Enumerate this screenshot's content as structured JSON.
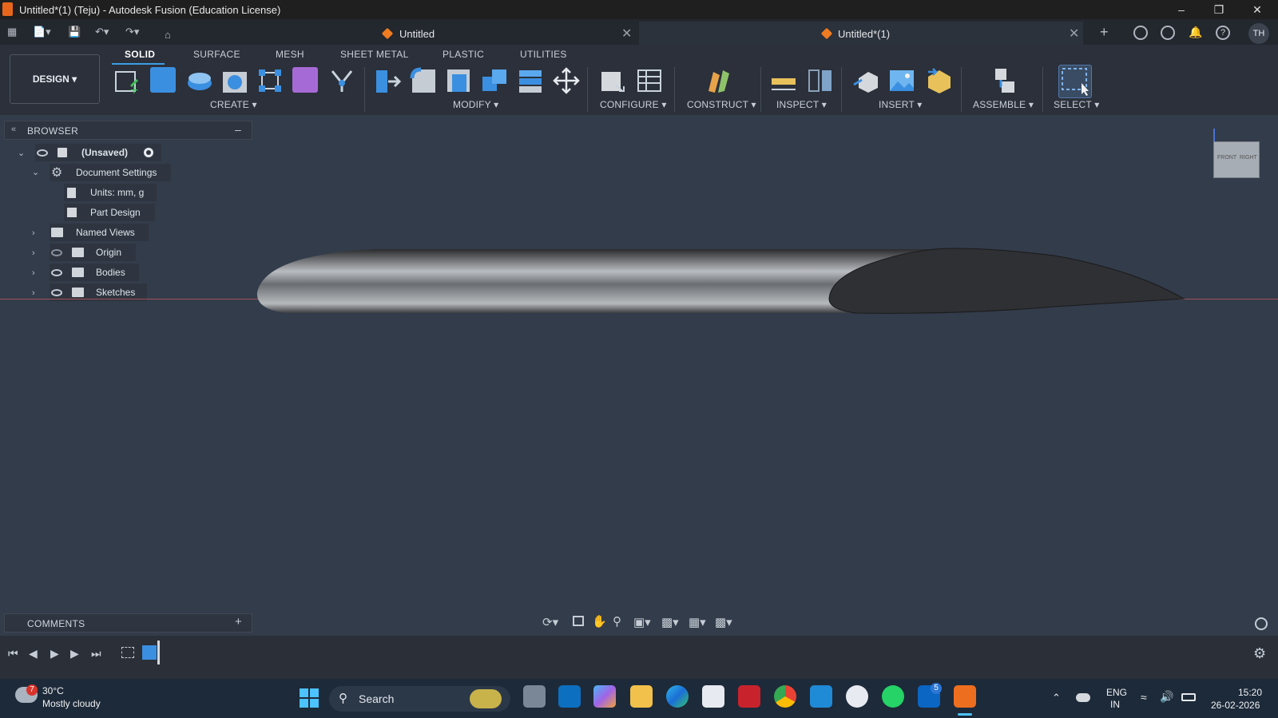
{
  "window": {
    "title": "Untitled*(1) (Teju) - Autodesk Fusion (Education License)"
  },
  "tabs": [
    {
      "label": "Untitled"
    },
    {
      "label": "Untitled*(1)"
    }
  ],
  "user": {
    "initials": "TH"
  },
  "workspace": {
    "label": "DESIGN ▾"
  },
  "ribbon_tabs": [
    "SOLID",
    "SURFACE",
    "MESH",
    "SHEET METAL",
    "PLASTIC",
    "UTILITIES"
  ],
  "groups": {
    "create": "CREATE ▾",
    "modify": "MODIFY ▾",
    "configure": "CONFIGURE ▾",
    "construct": "CONSTRUCT ▾",
    "inspect": "INSPECT ▾",
    "insert": "INSERT ▾",
    "assemble": "ASSEMBLE ▾",
    "select": "SELECT ▾"
  },
  "browser": {
    "title": "BROWSER",
    "root": "(Unsaved)",
    "items": [
      {
        "label": "Document Settings"
      },
      {
        "label": "Units: mm, g"
      },
      {
        "label": "Part Design"
      },
      {
        "label": "Named Views"
      },
      {
        "label": "Origin"
      },
      {
        "label": "Bodies"
      },
      {
        "label": "Sketches"
      }
    ]
  },
  "viewcube": {
    "front": "FRONT",
    "right": "RIGHT"
  },
  "comments": {
    "title": "COMMENTS"
  },
  "taskbar": {
    "weather_temp": "30°C",
    "weather_desc": "Mostly cloudy",
    "weather_badge": "7",
    "search_label": "Search",
    "lang_top": "ENG",
    "lang_bottom": "IN",
    "time": "15:20",
    "date": "26-02-2026",
    "linkedin_badge": "5"
  },
  "colors": {
    "accent": "#3c9ee5",
    "fusion_orange": "#f07c22",
    "axis_red": "#b9585c"
  }
}
